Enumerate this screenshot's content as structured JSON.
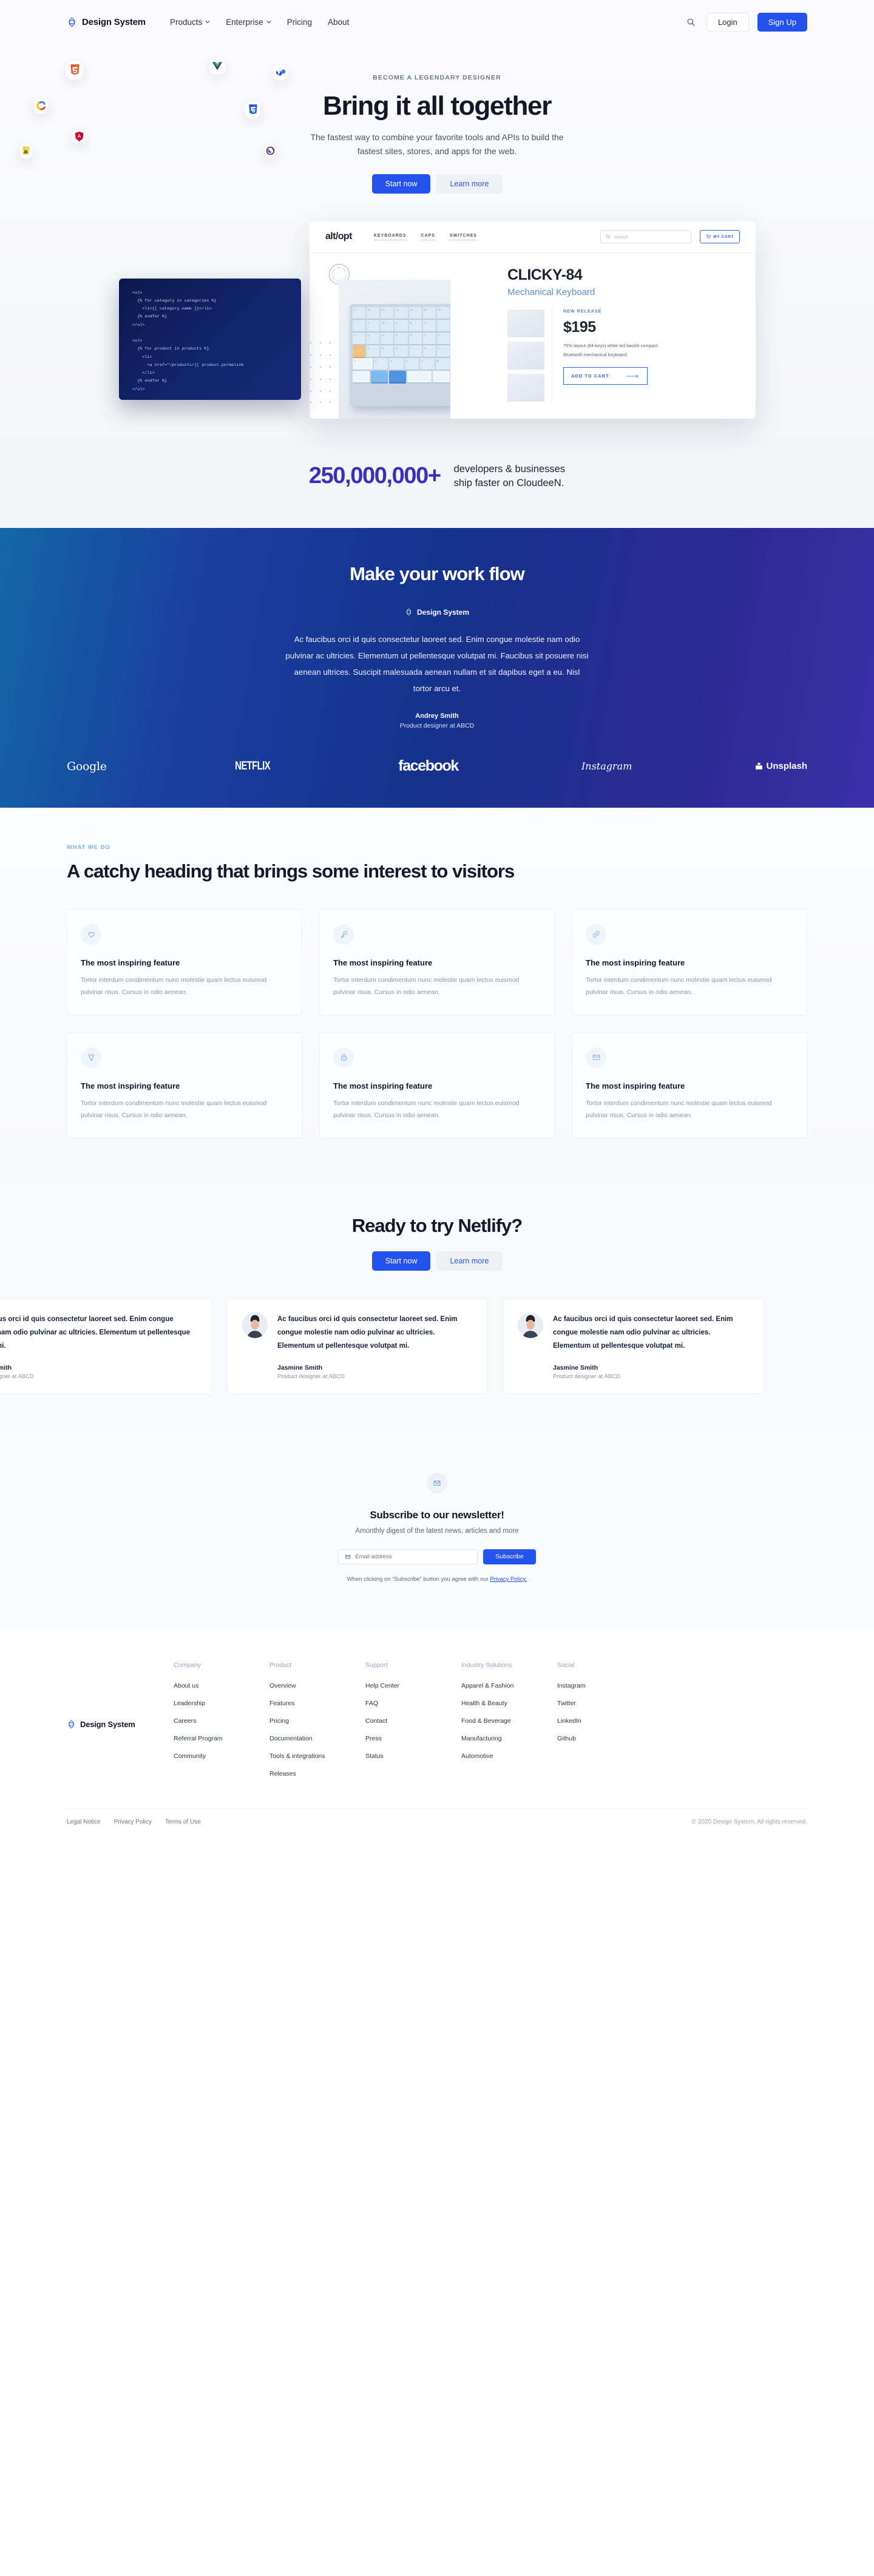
{
  "nav": {
    "brand": "Design System",
    "links": [
      {
        "label": "Products",
        "caret": true
      },
      {
        "label": "Enterprise",
        "caret": true
      },
      {
        "label": "Pricing",
        "caret": false
      },
      {
        "label": "About",
        "caret": false
      }
    ],
    "search_icon": "search-icon",
    "login_label": "Login",
    "signup_label": "Sign Up"
  },
  "hero": {
    "eyebrow": "BECOME A LEGENDARY DESIGNER",
    "title": "Bring it all together",
    "subtitle": "The fastest way to combine your favorite tools and APIs to build the fastest sites, stores, and apps for the web.",
    "primary_cta": "Start now",
    "secondary_cta": "Learn more",
    "float_icons": [
      "html5-icon",
      "vue-icon",
      "material-ui-icon",
      "chrome-c-icon",
      "css3-icon",
      "angular-icon",
      "javascript-icon",
      "gatsby-icon"
    ]
  },
  "mockup": {
    "shop_logo": "alt/opt",
    "shop_nav": [
      "KEYBOARDS",
      "CAPS",
      "SWITCHES"
    ],
    "search_placeholder": "search",
    "cart_label": "MY CART",
    "seal_text": "BEST SELLER · BEST SELLER ·",
    "product_title": "CLICKY-84",
    "product_subtitle": "Mechanical Keyboard",
    "badge": "NEW RELEASE",
    "price": "$195",
    "description": "75% layout (84-keys) white led backlit compact Bluetooth mechanical keyboard.",
    "add_to_cart": "ADD TO CART",
    "code": "<ul>\n  {% for category in categories %}\n    <li>{{ category.name }}</li>\n  {% endfor %}\n</ul>\n\n<ul>\n  {% for product in products %}\n    <li>\n      <a href=\"/products/{{ product.permalink\n    </li>\n  {% endfor %}\n</ul>"
  },
  "stats": {
    "number": "250,000,000+",
    "text_line1": "developers & businesses",
    "text_line2": "ship faster on CloudeeN."
  },
  "band": {
    "title": "Make your work flow",
    "brand": "Design System",
    "quote": "Ac faucibus orci id quis consectetur laoreet sed. Enim congue molestie nam odio pulvinar ac ultricies. Elementum ut pellentesque volutpat mi. Faucibus sit posuere nisi aenean ultrices. Suscipit malesuada aenean nullam et sit dapibus eget a eu. Nisl tortor arcu et.",
    "author": "Andrey Smith",
    "role": "Product designer at ABCD",
    "logos": [
      "Google",
      "NETFLIX",
      "facebook",
      "Instagram",
      "Unsplash"
    ]
  },
  "features": {
    "eyebrow": "WHAT WE DO",
    "heading": "A catchy heading that brings some interest to visitors",
    "cards": [
      {
        "icon": "heart-icon",
        "title": "The most inspiring feature",
        "text": "Tortor interdum condimentum nunc molestie quam lectus euismod pulvinar risus. Cursus in odio aenean."
      },
      {
        "icon": "key-icon",
        "title": "The most inspiring feature",
        "text": "Tortor interdum condimentum nunc molestie quam lectus euismod pulvinar risus. Cursus in odio aenean."
      },
      {
        "icon": "link-icon",
        "title": "The most inspiring feature",
        "text": "Tortor interdum condimentum nunc molestie quam lectus euismod pulvinar risus. Cursus in odio aenean."
      },
      {
        "icon": "lightbulb-icon",
        "title": "The most inspiring feature",
        "text": "Tortor interdum condimentum nunc molestie quam lectus euismod pulvinar risus. Cursus in odio aenean."
      },
      {
        "icon": "lock-icon",
        "title": "The most inspiring feature",
        "text": "Tortor interdum condimentum nunc molestie quam lectus euismod pulvinar risus. Cursus in odio aenean."
      },
      {
        "icon": "envelope-icon",
        "title": "The most inspiring feature",
        "text": "Tortor interdum condimentum nunc molestie quam lectus euismod pulvinar risus. Cursus in odio aenean."
      }
    ]
  },
  "cta": {
    "title": "Ready to try Netlify?",
    "primary": "Start now",
    "secondary": "Learn more"
  },
  "testimonials": [
    {
      "quote": "Ac faucibus orci id quis consectetur laoreet sed. Enim congue molestie nam odio pulvinar ac ultricies. Elementum ut pellentesque volutpat mi.",
      "name": "Jasmine Smith",
      "role": "Product designer at ABCD",
      "has_avatar": false
    },
    {
      "quote": "Ac faucibus orci id quis consectetur laoreet sed. Enim congue molestie nam odio pulvinar ac ultricies. Elementum ut pellentesque volutpat mi.",
      "name": "Jasmine Smith",
      "role": "Product designer at ABCD",
      "has_avatar": true
    },
    {
      "quote": "Ac faucibus orci id quis consectetur laoreet sed. Enim congue molestie nam odio pulvinar ac ultricies. Elementum ut pellentesque volutpat mi.",
      "name": "Jasmine Smith",
      "role": "Product designer at ABCD",
      "has_avatar": true
    }
  ],
  "newsletter": {
    "icon": "envelope-icon",
    "title": "Subscribe to our newsletter!",
    "subtitle": "Amonthly digest of the latest news, articles and more",
    "placeholder": "Email address",
    "button": "Subscribe",
    "note_prefix": "When clicking on “Subscribe” button you agree with our ",
    "note_link": "Privacy Policy."
  },
  "footer": {
    "brand": "Design System",
    "columns": [
      {
        "title": "Company",
        "links": [
          "About us",
          "Leadership",
          "Careers",
          "Referral Program",
          "Community"
        ]
      },
      {
        "title": "Product",
        "links": [
          "Overview",
          "Features",
          "Pricing",
          "Documentation",
          "Tools & integrations",
          "Releases"
        ]
      },
      {
        "title": "Support",
        "links": [
          "Help Center",
          "FAQ",
          "Contact",
          "Press",
          "Status"
        ]
      },
      {
        "title": "Industry Solutions",
        "links": [
          "Apparel & Fashion",
          "Health & Beauty",
          "Food & Beverage",
          "Manufacturing",
          "Automotive"
        ]
      },
      {
        "title": "Social",
        "links": [
          "Instagram",
          "Twitter",
          "LinkedIn",
          "Github"
        ]
      }
    ],
    "legal": [
      "Legal Notice",
      "Privacy Policy",
      "Terms of Use"
    ],
    "copyright": "© 2020 Design System. All rights reserved."
  },
  "colors": {
    "accent": "#2353ec",
    "band_blue": "#15328e",
    "stat_purple": "#3b2fbd",
    "icon_blue": "#78b2e8"
  }
}
